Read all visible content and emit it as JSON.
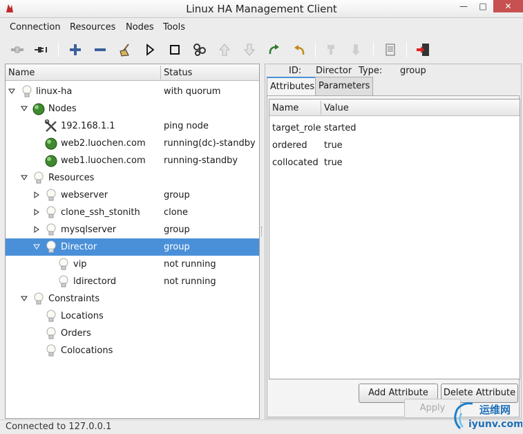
{
  "window": {
    "title": "Linux HA Management Client",
    "min_glyph": "—",
    "max_glyph": "□",
    "close_glyph": "✕"
  },
  "menu": [
    "Connection",
    "Resources",
    "Nodes",
    "Tools"
  ],
  "toolbar": {
    "icons": [
      "connect-icon",
      "disconnect-icon",
      "add-icon",
      "remove-icon",
      "cleanup-icon",
      "start-icon",
      "stop-icon",
      "manage-icon",
      "move-up-icon",
      "move-down-icon",
      "refresh-icon",
      "undo-icon",
      "standby-icon",
      "active-icon",
      "view-log-icon",
      "exit-icon"
    ]
  },
  "tree": {
    "col_name": "Name",
    "col_status": "Status",
    "rows": [
      {
        "label": "linux-ha",
        "status": "with quorum"
      },
      {
        "label": "Nodes",
        "status": ""
      },
      {
        "label": "192.168.1.1",
        "status": "ping node"
      },
      {
        "label": "web2.luochen.com",
        "status": "running(dc)-standby"
      },
      {
        "label": "web1.luochen.com",
        "status": "running-standby"
      },
      {
        "label": "Resources",
        "status": ""
      },
      {
        "label": "webserver",
        "status": "group"
      },
      {
        "label": "clone_ssh_stonith",
        "status": "clone"
      },
      {
        "label": "mysqlserver",
        "status": "group"
      },
      {
        "label": "Director",
        "status": "group"
      },
      {
        "label": "vip",
        "status": "not running"
      },
      {
        "label": "ldirectord",
        "status": "not running"
      },
      {
        "label": "Constraints",
        "status": ""
      },
      {
        "label": "Locations",
        "status": ""
      },
      {
        "label": "Orders",
        "status": ""
      },
      {
        "label": "Colocations",
        "status": ""
      }
    ]
  },
  "details": {
    "id_label": "ID:",
    "id_value": "Director",
    "type_label": "Type:",
    "type_value": "group",
    "tabs": [
      "Attributes",
      "Parameters"
    ],
    "col_name": "Name",
    "col_value": "Value",
    "attributes": [
      {
        "name": "target_role",
        "value": "started"
      },
      {
        "name": "ordered",
        "value": "true"
      },
      {
        "name": "collocated",
        "value": "true"
      }
    ],
    "add_button": "Add Attribute",
    "delete_button": "Delete Attribute",
    "apply_button": "Apply"
  },
  "status_bar": "Connected to 127.0.0.1",
  "watermark": {
    "cn": "运维网",
    "url": "iyunv.com"
  }
}
